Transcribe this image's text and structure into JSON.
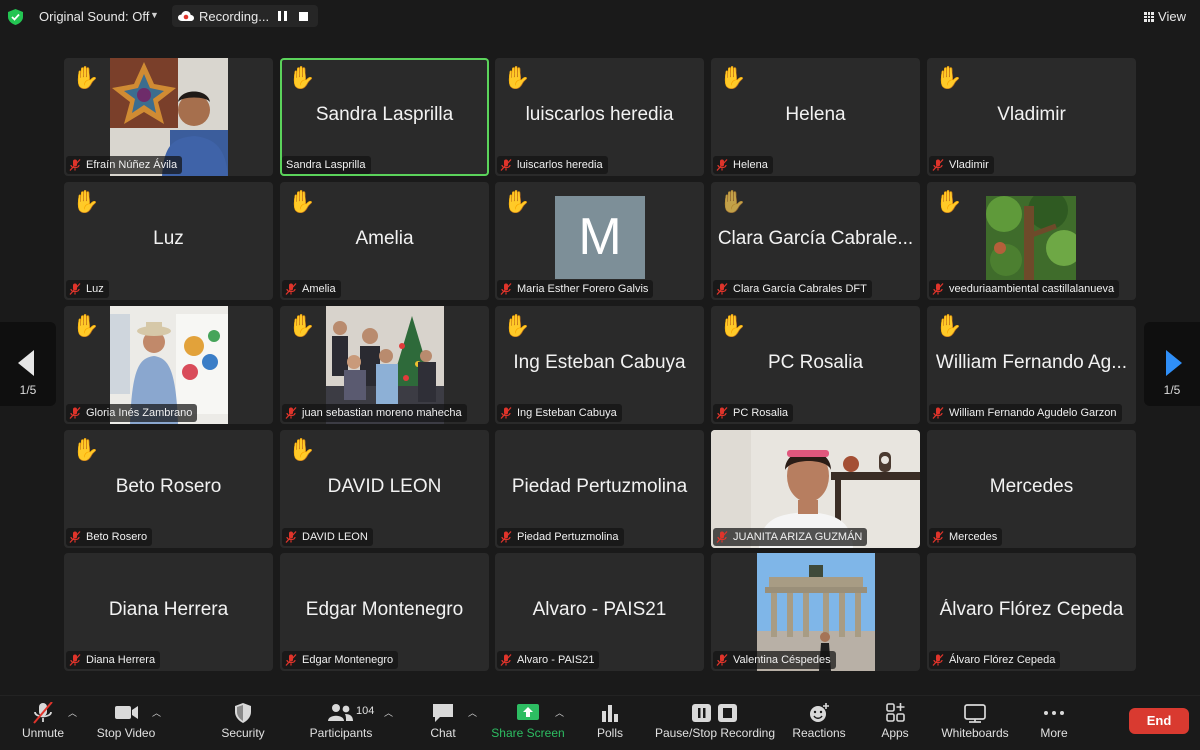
{
  "topbar": {
    "original_sound": "Original Sound: Off",
    "recording": "Recording...",
    "view": "View"
  },
  "paging": {
    "left": "1/5",
    "right": "1/5"
  },
  "tiles": [
    {
      "center": "",
      "label": "Efraín Núñez Ávila",
      "hand": true,
      "photo": "painting-man",
      "muted": true
    },
    {
      "center": "Sandra Lasprilla",
      "label": "Sandra Lasprilla",
      "hand": true,
      "active": true,
      "muted": false
    },
    {
      "center": "luiscarlos heredia",
      "label": "luiscarlos heredia",
      "hand": true,
      "muted": true
    },
    {
      "center": "Helena",
      "label": "Helena",
      "hand": true,
      "muted": true
    },
    {
      "center": "Vladimir",
      "label": "Vladimir",
      "hand": true,
      "muted": true
    },
    {
      "center": "Luz",
      "label": "Luz",
      "hand": true,
      "muted": true
    },
    {
      "center": "Amelia",
      "label": "Amelia",
      "hand": true,
      "muted": true
    },
    {
      "center": "",
      "label": "Maria Esther Forero Galvis",
      "hand": true,
      "avatar_letter": "M",
      "muted": true
    },
    {
      "center": "Clara García Cabrale...",
      "label": "Clara García Cabrales DFT",
      "hand": true,
      "hand_dark": true,
      "muted": true
    },
    {
      "center": "",
      "label": "veeduriaambiental castillalanueva",
      "hand": true,
      "photo": "tree",
      "muted": true
    },
    {
      "center": "",
      "label": "Gloria Inés Zambrano",
      "hand": true,
      "photo": "speaker",
      "muted": true
    },
    {
      "center": "",
      "label": "juan sebastian moreno mahecha",
      "hand": true,
      "photo": "family",
      "muted": true
    },
    {
      "center": "Ing Esteban Cabuya",
      "label": "Ing Esteban Cabuya",
      "hand": true,
      "muted": true
    },
    {
      "center": "PC Rosalia",
      "label": "PC Rosalia",
      "hand": true,
      "muted": true
    },
    {
      "center": "William Fernando Ag...",
      "label": "William Fernando Agudelo Garzon",
      "hand": true,
      "muted": true
    },
    {
      "center": "Beto Rosero",
      "label": "Beto Rosero",
      "hand": true,
      "muted": true
    },
    {
      "center": "DAVID LEON",
      "label": "DAVID LEON",
      "hand": true,
      "muted": true
    },
    {
      "center": "Piedad Pertuzmolina",
      "label": "Piedad Pertuzmolina",
      "hand": false,
      "muted": true
    },
    {
      "center": "",
      "label": "JUANITA ARIZA GUZMÁN",
      "hand": false,
      "photo": "video-woman",
      "muted": true
    },
    {
      "center": "Mercedes",
      "label": "Mercedes",
      "hand": false,
      "muted": true
    },
    {
      "center": "Diana Herrera",
      "label": "Diana Herrera",
      "hand": false,
      "muted": true
    },
    {
      "center": "Edgar Montenegro",
      "label": "Edgar Montenegro",
      "hand": false,
      "muted": true
    },
    {
      "center": "Alvaro - PAIS21",
      "label": "Alvaro - PAIS21",
      "hand": false,
      "muted": true
    },
    {
      "center": "",
      "label": "Valentina Céspedes",
      "hand": false,
      "photo": "gate",
      "muted": true
    },
    {
      "center": "Álvaro Flórez Cepeda",
      "label": "Álvaro Flórez Cepeda",
      "hand": false,
      "muted": true
    }
  ],
  "toolbar": {
    "unmute": "Unmute",
    "stop_video": "Stop Video",
    "security": "Security",
    "participants": "Participants",
    "participants_count": "104",
    "chat": "Chat",
    "share_screen": "Share Screen",
    "polls": "Polls",
    "pause_stop_recording": "Pause/Stop Recording",
    "reactions": "Reactions",
    "apps": "Apps",
    "whiteboards": "Whiteboards",
    "more": "More",
    "end": "End"
  },
  "colors": {
    "active_border": "#5bd35b",
    "share_green": "#2dbd62",
    "end_red": "#d93a30",
    "tile_bg": "#2a2a2a"
  }
}
